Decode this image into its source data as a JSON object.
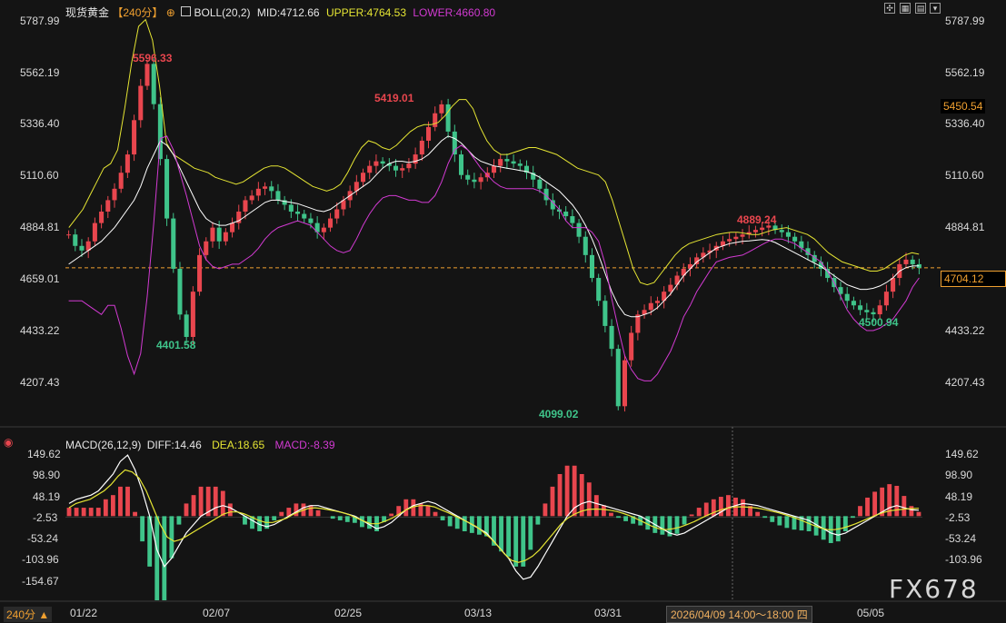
{
  "header": {
    "symbol": "现货黄金",
    "period": "【240分】",
    "indicator": "BOLL(20,2)",
    "mid": "MID:4712.66",
    "upper": "UPPER:4764.53",
    "lower": "LOWER:4660.80"
  },
  "macd_header": {
    "name": "MACD(26,12,9)",
    "diff": "DIFF:14.46",
    "dea": "DEA:18.65",
    "macd": "MACD:-8.39"
  },
  "price_axis": [
    "5787.99",
    "5562.19",
    "5336.40",
    "5110.60",
    "4884.81",
    "4659.01",
    "4433.22",
    "4207.43"
  ],
  "macd_axis": [
    "149.62",
    "98.90",
    "48.19",
    "-2.53",
    "-53.24",
    "-103.96",
    "-154.67"
  ],
  "x_labels": [
    "01/22",
    "02/07",
    "02/25",
    "03/13",
    "03/31",
    "05/05"
  ],
  "annotations": {
    "high1": "5596.33",
    "low1": "4401.58",
    "high2": "5419.01",
    "low2": "4099.02",
    "high3": "4889.24",
    "low3": "4500.94"
  },
  "tags": {
    "current": "4704.12",
    "cursor": "5450.54"
  },
  "footer": {
    "period": "240分 ▲",
    "crosshair_time": "2026/04/09 14:00～18:00 四"
  },
  "watermark": "FX678",
  "colors": {
    "up": "#e8464e",
    "down": "#3fc48a",
    "mid": "#ffffff",
    "upper": "#e5e533",
    "lower": "#d23ad2",
    "dea": "#e5e533",
    "diff": "#ffffff",
    "current": "#f0a030"
  },
  "chart_data": {
    "type": "candlestick",
    "series": [
      {
        "name": "BOLL(20,2)",
        "x": [
          "01/22",
          "02/07",
          "02/25",
          "03/13",
          "03/31",
          "05/05"
        ]
      }
    ],
    "price_ylim": [
      4207.43,
      5787.99
    ],
    "macd_ylim": [
      -154.67,
      149.62
    ],
    "current_price": 4704.12,
    "close": [
      4850,
      4800,
      4780,
      4820,
      4900,
      4950,
      5000,
      5050,
      5120,
      5200,
      5350,
      5500,
      5596,
      5420,
      5180,
      4920,
      4700,
      4500,
      4402,
      4600,
      4760,
      4820,
      4880,
      4820,
      4860,
      4900,
      4950,
      5000,
      5020,
      5050,
      5060,
      5040,
      5000,
      4980,
      4950,
      4940,
      4920,
      4900,
      4860,
      4880,
      4920,
      4960,
      5000,
      5040,
      5080,
      5120,
      5150,
      5170,
      5160,
      5150,
      5130,
      5140,
      5160,
      5200,
      5260,
      5320,
      5380,
      5419,
      5300,
      5200,
      5110,
      5090,
      5080,
      5100,
      5120,
      5150,
      5180,
      5170,
      5160,
      5150,
      5120,
      5090,
      5050,
      5000,
      4960,
      4950,
      4930,
      4900,
      4840,
      4760,
      4660,
      4560,
      4450,
      4350,
      4099,
      4300,
      4420,
      4500,
      4520,
      4550,
      4560,
      4600,
      4630,
      4670,
      4700,
      4720,
      4750,
      4770,
      4780,
      4800,
      4820,
      4830,
      4840,
      4850,
      4860,
      4870,
      4880,
      4889,
      4870,
      4860,
      4840,
      4820,
      4790,
      4760,
      4730,
      4700,
      4660,
      4620,
      4590,
      4560,
      4540,
      4520,
      4510,
      4501,
      4540,
      4600,
      4660,
      4720,
      4740,
      4720,
      4704
    ],
    "boll_mid": [
      4720,
      4740,
      4760,
      4780,
      4800,
      4820,
      4850,
      4880,
      4920,
      4960,
      5000,
      5060,
      5140,
      5200,
      5260,
      5240,
      5200,
      5140,
      5080,
      5020,
      4960,
      4920,
      4900,
      4890,
      4890,
      4900,
      4910,
      4930,
      4950,
      4970,
      4990,
      5000,
      5000,
      4995,
      4990,
      4985,
      4975,
      4965,
      4955,
      4950,
      4960,
      4980,
      5000,
      5020,
      5040,
      5060,
      5080,
      5110,
      5140,
      5160,
      5170,
      5170,
      5165,
      5170,
      5180,
      5200,
      5230,
      5260,
      5280,
      5270,
      5250,
      5220,
      5190,
      5170,
      5160,
      5150,
      5145,
      5140,
      5135,
      5130,
      5125,
      5115,
      5100,
      5080,
      5060,
      5040,
      5010,
      4980,
      4940,
      4890,
      4830,
      4760,
      4680,
      4600,
      4540,
      4500,
      4490,
      4490,
      4500,
      4510,
      4530,
      4560,
      4590,
      4630,
      4670,
      4700,
      4730,
      4750,
      4770,
      4790,
      4800,
      4810,
      4815,
      4820,
      4822,
      4825,
      4828,
      4825,
      4815,
      4800,
      4785,
      4770,
      4755,
      4740,
      4725,
      4710,
      4690,
      4670,
      4650,
      4630,
      4620,
      4610,
      4610,
      4615,
      4625,
      4640,
      4660,
      4690,
      4705,
      4712,
      4713
    ],
    "boll_upper": [
      4880,
      4920,
      4960,
      5020,
      5080,
      5140,
      5160,
      5220,
      5400,
      5600,
      5760,
      5790,
      5700,
      5500,
      5250,
      5200,
      5180,
      5160,
      5140,
      5130,
      5120,
      5100,
      5090,
      5080,
      5070,
      5080,
      5100,
      5120,
      5140,
      5150,
      5150,
      5140,
      5120,
      5100,
      5080,
      5060,
      5050,
      5040,
      5050,
      5070,
      5120,
      5180,
      5230,
      5260,
      5250,
      5230,
      5220,
      5240,
      5270,
      5300,
      5320,
      5330,
      5330,
      5340,
      5370,
      5410,
      5440,
      5440,
      5400,
      5320,
      5260,
      5220,
      5200,
      5200,
      5210,
      5220,
      5230,
      5230,
      5220,
      5210,
      5200,
      5180,
      5160,
      5140,
      5130,
      5120,
      5110,
      5080,
      5000,
      4900,
      4800,
      4700,
      4640,
      4630,
      4640,
      4680,
      4720,
      4760,
      4790,
      4810,
      4820,
      4830,
      4840,
      4850,
      4855,
      4860,
      4860,
      4855,
      4850,
      4850,
      4860,
      4870,
      4875,
      4880,
      4870,
      4860,
      4850,
      4830,
      4800,
      4770,
      4750,
      4730,
      4720,
      4710,
      4700,
      4690,
      4690,
      4700,
      4720,
      4740,
      4760,
      4770,
      4764
    ],
    "boll_lower": [
      4560,
      4560,
      4560,
      4540,
      4520,
      4500,
      4540,
      4540,
      4440,
      4320,
      4240,
      4330,
      4580,
      4900,
      5270,
      5280,
      5220,
      5120,
      5020,
      4910,
      4800,
      4740,
      4710,
      4700,
      4710,
      4720,
      4720,
      4740,
      4760,
      4790,
      4830,
      4860,
      4880,
      4890,
      4900,
      4910,
      4900,
      4890,
      4860,
      4830,
      4800,
      4780,
      4770,
      4780,
      4830,
      4890,
      4940,
      4980,
      5010,
      5020,
      5020,
      5010,
      5000,
      5000,
      4990,
      4990,
      5020,
      5080,
      5160,
      5220,
      5240,
      5220,
      5180,
      5140,
      5110,
      5080,
      5060,
      5050,
      5050,
      5050,
      5050,
      5050,
      5040,
      5020,
      4990,
      4960,
      4910,
      4880,
      4880,
      4880,
      4860,
      4820,
      4720,
      4570,
      4440,
      4320,
      4260,
      4220,
      4210,
      4210,
      4240,
      4290,
      4340,
      4410,
      4490,
      4540,
      4600,
      4645,
      4690,
      4730,
      4740,
      4750,
      4755,
      4760,
      4774,
      4790,
      4806,
      4820,
      4830,
      4830,
      4820,
      4810,
      4790,
      4770,
      4750,
      4730,
      4690,
      4640,
      4580,
      4520,
      4480,
      4450,
      4430,
      4430,
      4440,
      4460,
      4480,
      4520,
      4560,
      4620,
      4660
    ],
    "diff": [
      30,
      40,
      45,
      50,
      60,
      80,
      100,
      130,
      145,
      110,
      60,
      0,
      -80,
      -120,
      -100,
      -70,
      -40,
      -20,
      0,
      10,
      20,
      25,
      20,
      10,
      0,
      -10,
      -20,
      -25,
      -20,
      -10,
      0,
      10,
      20,
      25,
      25,
      20,
      15,
      10,
      5,
      0,
      -10,
      -20,
      -30,
      -25,
      -15,
      0,
      15,
      25,
      30,
      35,
      30,
      20,
      10,
      0,
      -10,
      -20,
      -30,
      -40,
      -60,
      -80,
      -100,
      -130,
      -150,
      -145,
      -120,
      -90,
      -60,
      -30,
      0,
      20,
      30,
      35,
      30,
      25,
      20,
      15,
      10,
      5,
      0,
      -10,
      -20,
      -30,
      -40,
      -45,
      -40,
      -30,
      -20,
      -10,
      0,
      10,
      20,
      25,
      30,
      28,
      25,
      20,
      15,
      10,
      5,
      0,
      -5,
      -10,
      -20,
      -30,
      -40,
      -45,
      -40,
      -30,
      -20,
      -10,
      0,
      10,
      20,
      25,
      20,
      15,
      14
    ],
    "dea": [
      20,
      30,
      35,
      40,
      50,
      60,
      75,
      95,
      110,
      105,
      90,
      60,
      20,
      -20,
      -50,
      -60,
      -55,
      -45,
      -35,
      -25,
      -15,
      -5,
      5,
      10,
      10,
      5,
      -2,
      -10,
      -15,
      -15,
      -10,
      -5,
      5,
      12,
      18,
      20,
      18,
      15,
      12,
      8,
      3,
      -5,
      -12,
      -18,
      -18,
      -12,
      -5,
      5,
      15,
      22,
      25,
      25,
      22,
      15,
      8,
      0,
      -8,
      -16,
      -25,
      -38,
      -52,
      -70,
      -90,
      -105,
      -110,
      -105,
      -95,
      -80,
      -60,
      -40,
      -20,
      -5,
      5,
      12,
      16,
      17,
      16,
      14,
      11,
      6,
      0,
      -8,
      -16,
      -24,
      -30,
      -32,
      -30,
      -26,
      -20,
      -13,
      -5,
      3,
      10,
      16,
      20,
      22,
      22,
      21,
      19,
      16,
      12,
      8,
      3,
      -2,
      -8,
      -15,
      -22,
      -28,
      -32,
      -32,
      -29,
      -24,
      -18,
      -11,
      -4,
      3,
      9,
      13,
      15,
      17,
      18,
      18.65
    ]
  }
}
